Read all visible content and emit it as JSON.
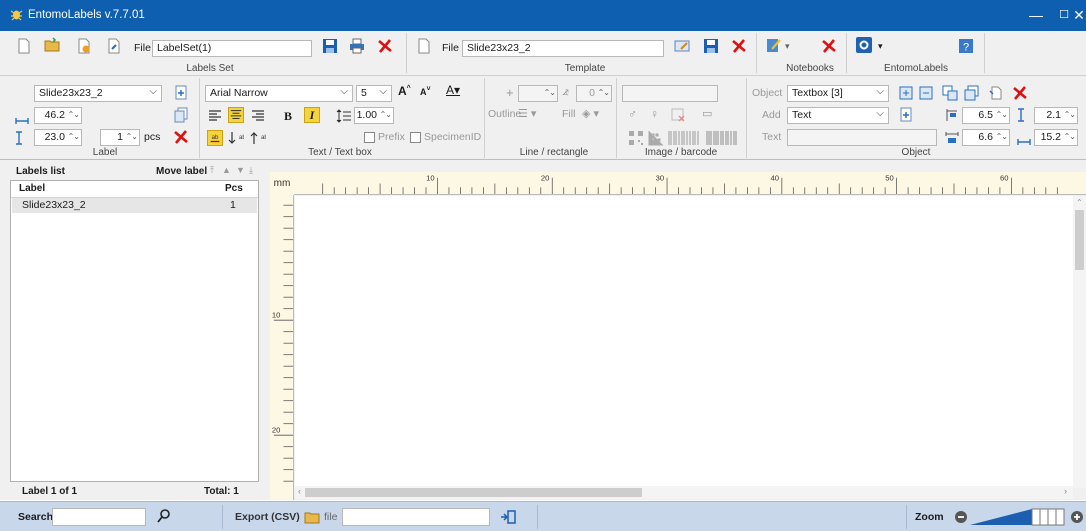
{
  "window": {
    "title": "EntomoLabels v.7.7.01",
    "min": "—",
    "max": "☐",
    "close": "✕"
  },
  "toolbar": {
    "file_label": "File",
    "labelset_file": "LabelSet(1)",
    "labelset_group": "Labels Set",
    "template_file_label": "File",
    "template_file": "Slide23x23_2",
    "template_group": "Template",
    "notebooks_group": "Notebooks",
    "entomolabels_group": "EntomoLabels"
  },
  "label_group": {
    "template_select": "Slide23x23_2",
    "width": "46.2",
    "height": "23.0",
    "pcs_value": "1",
    "pcs_label": "pcs",
    "title": "Label"
  },
  "text_group": {
    "font": "Arial Narrow",
    "size": "5",
    "line_spacing": "1.00",
    "bold": "B",
    "italic": "I",
    "prefix": "Prefix",
    "specimen_id": "SpecimenID",
    "title": "Text / Text box"
  },
  "line_group": {
    "value1": "",
    "value2": "0",
    "outline": "Outline",
    "fill": "Fill",
    "title": "Line / rectangle"
  },
  "image_group": {
    "title": "Image / barcode"
  },
  "object_group": {
    "object_label": "Object",
    "object_value": "Textbox [3]",
    "add_label": "Add",
    "add_value": "Text",
    "text_label": "Text",
    "text_value": "",
    "v1": "6.5",
    "v2": "2.1",
    "v3": "6.6",
    "v4": "15.2",
    "title": "Object"
  },
  "labels_list": {
    "title": "Labels list",
    "move_label": "Move label",
    "col_label": "Label",
    "col_pcs": "Pcs",
    "rows": [
      {
        "label": "Slide23x23_2",
        "pcs": "1"
      }
    ],
    "footer_left": "Label  1  of  1",
    "footer_right": "Total:  1"
  },
  "canvas": {
    "unit": "mm",
    "h_ticks": [
      "10",
      "20",
      "30",
      "40",
      "50",
      "60"
    ],
    "v_ticks": [
      "10",
      "20"
    ]
  },
  "statusbar": {
    "search_label": "Search",
    "search_value": "",
    "export_label": "Export (CSV)",
    "file_label": "file",
    "file_value": "",
    "zoom_label": "Zoom"
  },
  "colors": {
    "titlebar": "#0f5fb1",
    "statusbar": "#c8d7ea",
    "ruler": "#fdf8e4",
    "accent_yellow": "#f5d33b"
  }
}
